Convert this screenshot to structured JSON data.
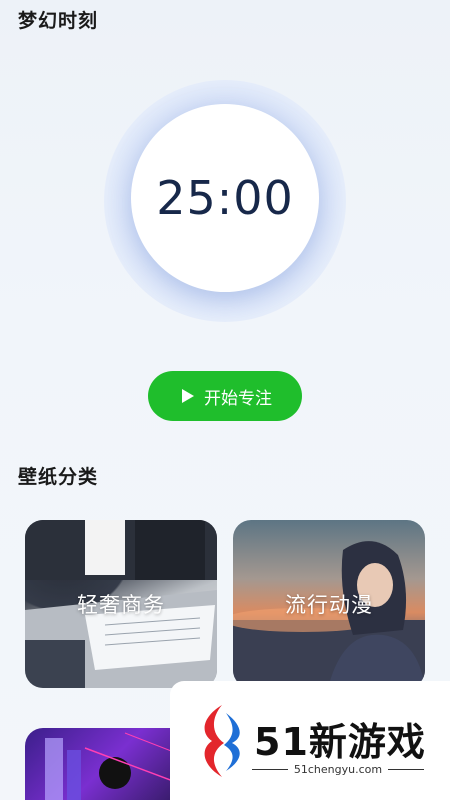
{
  "app": {
    "title": "梦幻时刻"
  },
  "timer": {
    "display": "25:00"
  },
  "start_button": {
    "label": "开始专注",
    "icon": "play-icon"
  },
  "wallpapers": {
    "section_title": "壁纸分类",
    "categories": [
      {
        "label": "轻奢商务"
      },
      {
        "label": "流行动漫"
      },
      {
        "label": ""
      }
    ]
  },
  "watermark": {
    "name": "51新游戏",
    "url": "51chengyu.com"
  },
  "colors": {
    "accent_green": "#1fbe2c",
    "timer_text": "#17284a",
    "background": "#f1f5fa"
  }
}
